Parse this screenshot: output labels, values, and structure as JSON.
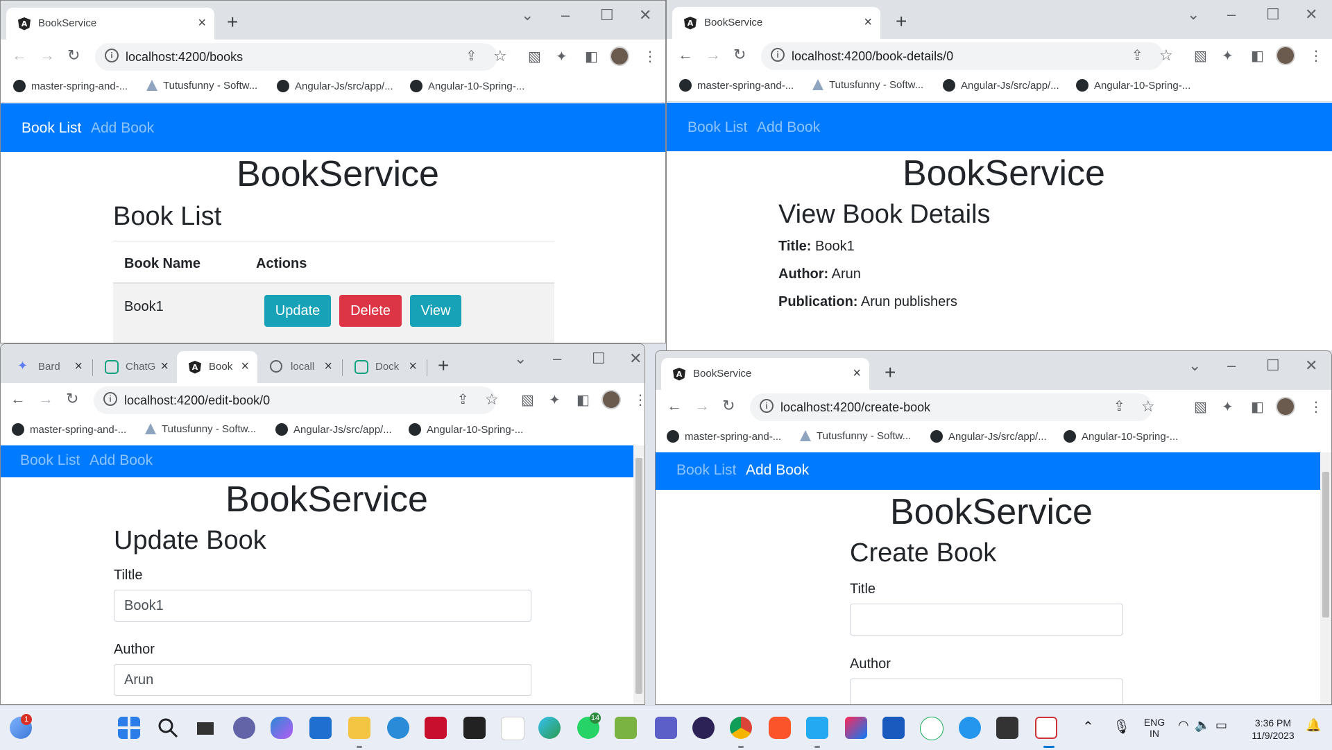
{
  "colors": {
    "navbar": "#007bff",
    "info": "#17a2b8",
    "danger": "#dc3545",
    "tabstrip": "#dee1e6"
  },
  "bookmarks": [
    "master-spring-and-...",
    "Tutusfunny - Softw...",
    "Angular-Js/src/app/...",
    "Angular-10-Spring-..."
  ],
  "nav": {
    "book_list": "Book List",
    "add_book": "Add Book"
  },
  "app_title": "BookService",
  "windows": {
    "list": {
      "tab_title": "BookService",
      "url": "localhost:4200/books",
      "heading": "Book List",
      "table": {
        "headers": [
          "Book Name",
          "Actions"
        ],
        "rows": [
          {
            "name": "Book1",
            "update": "Update",
            "delete": "Delete",
            "view": "View"
          }
        ]
      }
    },
    "details": {
      "tab_title": "BookService",
      "url": "localhost:4200/book-details/0",
      "heading": "View Book Details",
      "fields": [
        {
          "label": "Title:",
          "value": "Book1"
        },
        {
          "label": "Author:",
          "value": "Arun"
        },
        {
          "label": "Publication:",
          "value": "Arun publishers"
        }
      ]
    },
    "edit": {
      "tabs": [
        "Bard",
        "ChatG",
        "Book",
        "locall",
        "Dock"
      ],
      "url": "localhost:4200/edit-book/0",
      "heading": "Update Book",
      "title_label": "Tiltle",
      "title_value": "Book1",
      "author_label": "Author",
      "author_value": "Arun"
    },
    "create": {
      "tab_title": "BookService",
      "url": "localhost:4200/create-book",
      "heading": "Create Book",
      "title_label": "Title",
      "author_label": "Author"
    }
  },
  "taskbar": {
    "weather_badge": "1",
    "whatsapp_badge": "14",
    "lang_line1": "ENG",
    "lang_line2": "IN",
    "time": "3:36 PM",
    "date": "11/9/2023"
  }
}
